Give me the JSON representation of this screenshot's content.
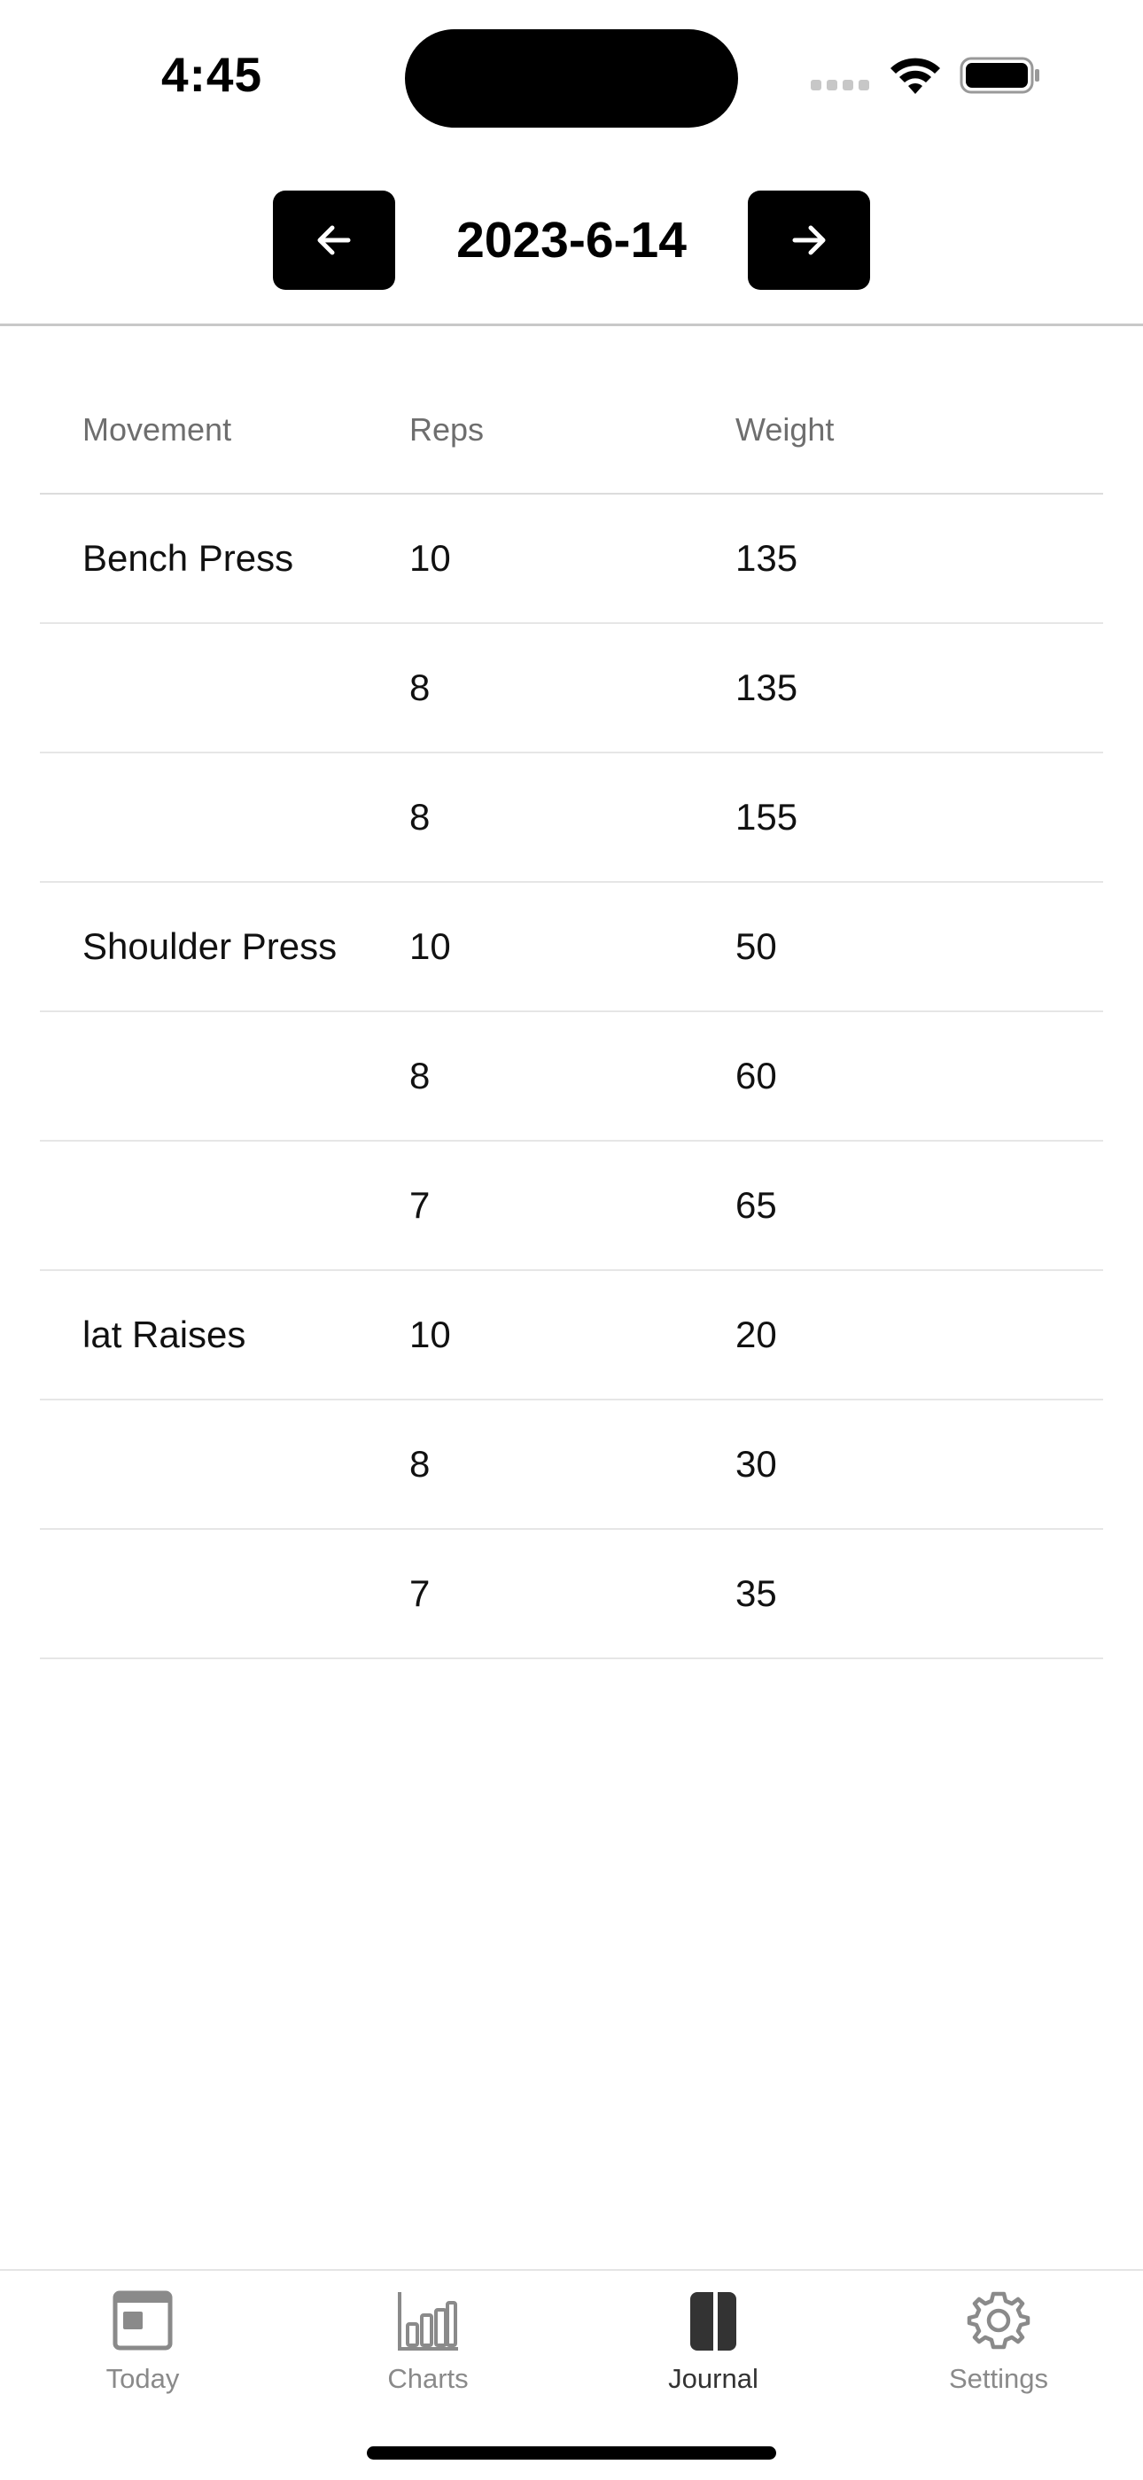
{
  "status_bar": {
    "time": "4:45",
    "icons": [
      "cellular-signal-icon",
      "wifi-icon",
      "battery-icon"
    ]
  },
  "date_nav": {
    "date": "2023-6-14",
    "prev_icon": "arrow-left-icon",
    "next_icon": "arrow-right-icon"
  },
  "table": {
    "headers": {
      "movement": "Movement",
      "reps": "Reps",
      "weight": "Weight"
    },
    "rows": [
      {
        "movement": "Bench Press",
        "reps": "10",
        "weight": "135"
      },
      {
        "movement": "",
        "reps": "8",
        "weight": "135"
      },
      {
        "movement": "",
        "reps": "8",
        "weight": "155"
      },
      {
        "movement": "Shoulder Press",
        "reps": "10",
        "weight": "50"
      },
      {
        "movement": "",
        "reps": "8",
        "weight": "60"
      },
      {
        "movement": "",
        "reps": "7",
        "weight": "65"
      },
      {
        "movement": "lat Raises",
        "reps": "10",
        "weight": "20"
      },
      {
        "movement": "",
        "reps": "8",
        "weight": "30"
      },
      {
        "movement": "",
        "reps": "7",
        "weight": "35"
      }
    ]
  },
  "tabbar": {
    "active": "Journal",
    "tabs": [
      {
        "label": "Today",
        "icon": "calendar-icon"
      },
      {
        "label": "Charts",
        "icon": "bar-chart-icon"
      },
      {
        "label": "Journal",
        "icon": "journal-book-icon"
      },
      {
        "label": "Settings",
        "icon": "gear-icon"
      }
    ]
  },
  "colors": {
    "accent": "#000000",
    "tab_inactive": "#8a8a8a",
    "tab_active": "#333333",
    "header_text": "#6e6e6e"
  }
}
